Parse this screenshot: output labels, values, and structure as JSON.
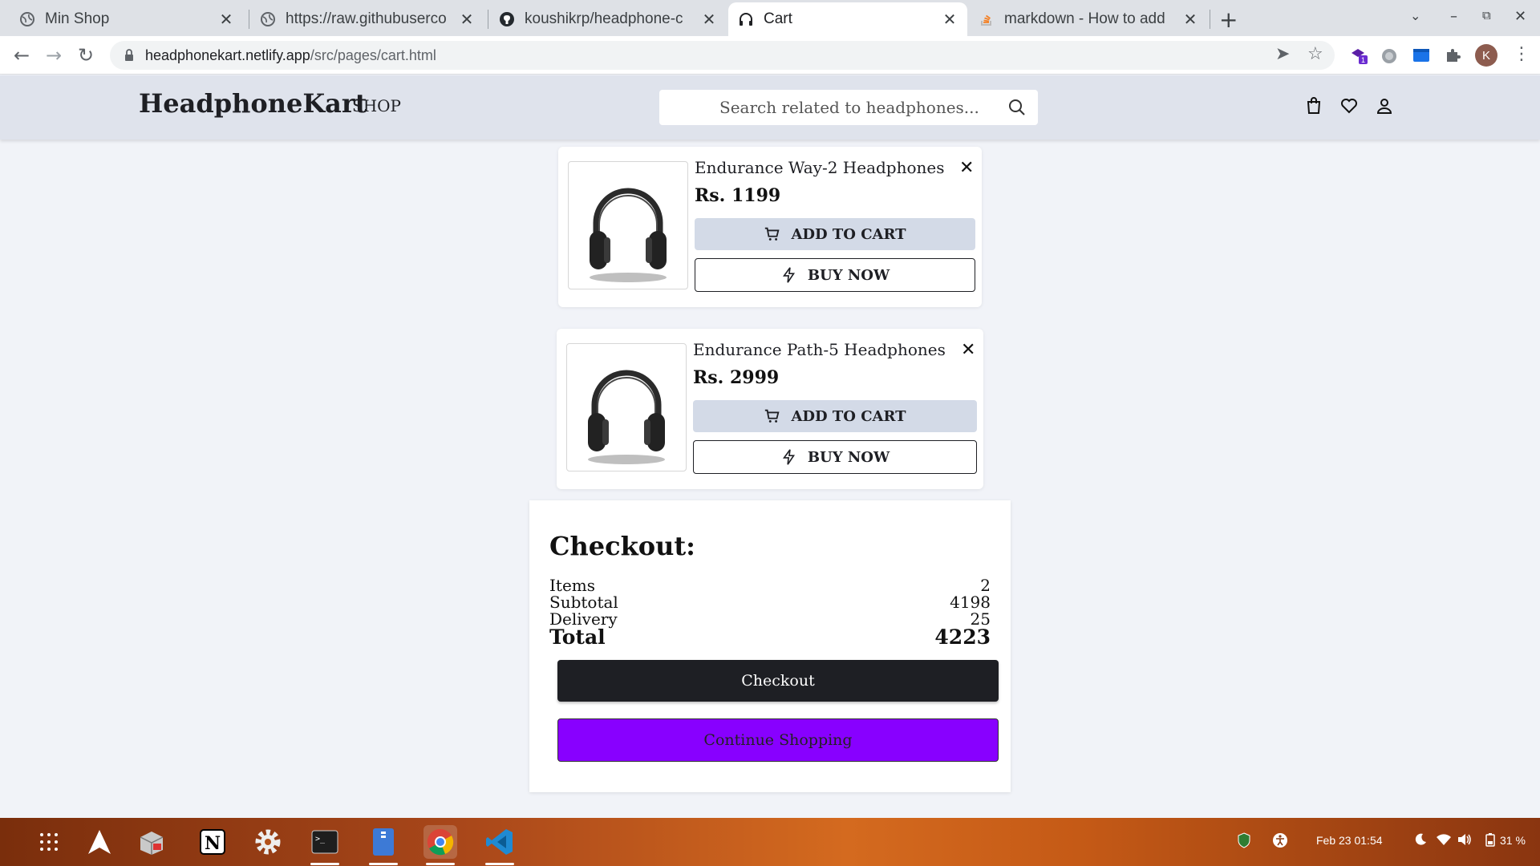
{
  "browser": {
    "tabs": [
      {
        "title": "Min Shop",
        "icon": "globe-icon"
      },
      {
        "title": "https://raw.githubuserco",
        "icon": "globe-icon"
      },
      {
        "title": "koushikrp/headphone-c",
        "icon": "github-icon"
      },
      {
        "title": "Cart",
        "icon": "headphones-icon",
        "active": true
      },
      {
        "title": "markdown - How to add",
        "icon": "stackoverflow-icon"
      }
    ],
    "url_host": "headphonekart.netlify.app",
    "url_path": "/src/pages/cart.html",
    "profile_initial": "K",
    "extension_badge": "1"
  },
  "site": {
    "brand": "HeadphoneKart",
    "shop_link": "SHOP",
    "search_placeholder": "Search related to headphones..."
  },
  "cart": {
    "items": [
      {
        "name": "Endurance Way-2 Headphones",
        "price": "Rs. 1199",
        "add_label": "ADD TO CART",
        "buy_label": "BUY NOW",
        "remove": "✕"
      },
      {
        "name": "Endurance Path-5 Headphones",
        "price": "Rs. 2999",
        "add_label": "ADD TO CART",
        "buy_label": "BUY NOW",
        "remove": "✕"
      }
    ]
  },
  "checkout": {
    "title": "Checkout:",
    "rows": [
      {
        "label": "Items",
        "value": "2"
      },
      {
        "label": "Subtotal",
        "value": "4198"
      },
      {
        "label": "Delivery",
        "value": "25"
      }
    ],
    "total_label": "Total",
    "total_value": "4223",
    "checkout_label": "Checkout",
    "continue_label": "Continue Shopping"
  },
  "taskbar": {
    "datetime": "Feb 23  01:54",
    "battery": "31 %"
  },
  "colors": {
    "brand_dark": "#1e1f24",
    "header_bg": "#dfe3ec",
    "add_btn_bg": "#d3dae7",
    "continue_bg": "#8800ff"
  }
}
